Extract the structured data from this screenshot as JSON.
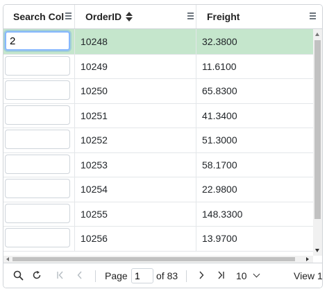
{
  "grid": {
    "columns": [
      {
        "id": "search",
        "label": "Search Col"
      },
      {
        "id": "orderid",
        "label": "OrderID"
      },
      {
        "id": "freight",
        "label": "Freight"
      }
    ],
    "sort": {
      "column": "OrderID",
      "direction": "none"
    },
    "rows": [
      {
        "search": "2",
        "orderid": "10248",
        "freight": "32.3800",
        "selected": true
      },
      {
        "search": "",
        "orderid": "10249",
        "freight": "11.6100"
      },
      {
        "search": "",
        "orderid": "10250",
        "freight": "65.8300"
      },
      {
        "search": "",
        "orderid": "10251",
        "freight": "41.3400"
      },
      {
        "search": "",
        "orderid": "10252",
        "freight": "51.3000"
      },
      {
        "search": "",
        "orderid": "10253",
        "freight": "58.1700"
      },
      {
        "search": "",
        "orderid": "10254",
        "freight": "22.9800"
      },
      {
        "search": "",
        "orderid": "10255",
        "freight": "148.3300"
      },
      {
        "search": "",
        "orderid": "10256",
        "freight": "13.9700"
      }
    ],
    "selected_row_color": "#c5e6cc"
  },
  "pager": {
    "icons": [
      "search-icon",
      "refresh-icon",
      "first-page-icon",
      "prev-page-icon",
      "next-page-icon",
      "last-page-icon",
      "chevron-down-icon"
    ],
    "page_label": "Page",
    "page_value": "1",
    "of_label": "of 83",
    "page_size": "10",
    "view_label": "View 1"
  }
}
